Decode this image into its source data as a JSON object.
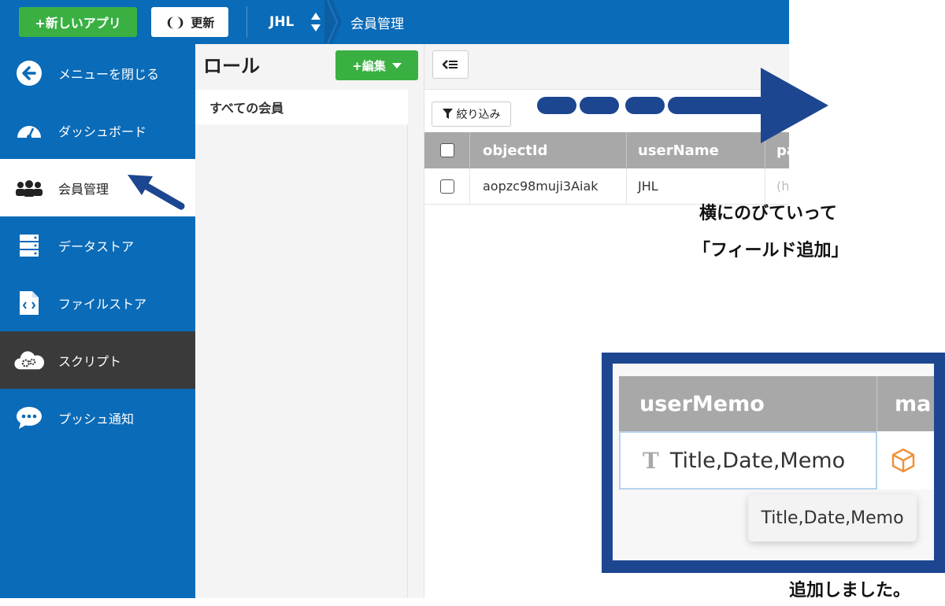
{
  "topbar": {
    "new_app_label": "+新しいアプリ",
    "refresh_label": "更新",
    "refresh_icon": "refresh-icon",
    "app_name": "JHL",
    "breadcrumb": "会員管理"
  },
  "sidebar": {
    "items": [
      {
        "label": "メニューを閉じる",
        "icon": "arrow-left-circle-icon"
      },
      {
        "label": "ダッシュボード",
        "icon": "gauge-icon"
      },
      {
        "label": "会員管理",
        "icon": "users-icon",
        "state": "active"
      },
      {
        "label": "データストア",
        "icon": "database-icon"
      },
      {
        "label": "ファイルストア",
        "icon": "file-code-icon"
      },
      {
        "label": "スクリプト",
        "icon": "cloud-gear-icon",
        "state": "dark"
      },
      {
        "label": "プッシュ通知",
        "icon": "chat-bubble-icon"
      }
    ]
  },
  "roles": {
    "title": "ロール",
    "edit_label": "+編集",
    "items": [
      "すべての会員"
    ]
  },
  "table": {
    "filter_label": "絞り込み",
    "columns": [
      "objectId",
      "userName",
      "pa"
    ],
    "rows": [
      {
        "objectId": "aopzc98muji3Aiak",
        "userName": "JHL",
        "partial": "(h"
      }
    ]
  },
  "annotations": {
    "extend_line1": "横にのびていって",
    "extend_line2": "「フィールド追加」",
    "done": "追加しました。"
  },
  "inset": {
    "columns": [
      "userMemo",
      "ma"
    ],
    "cell_value": "Title,Date,Memo",
    "type_icon": "T",
    "tooltip": "Title,Date,Memo"
  },
  "colors": {
    "brand_blue": "#0a6bb8",
    "green": "#3ab043",
    "annotation_navy": "#1d4691",
    "header_gray": "#a8a8a8"
  }
}
